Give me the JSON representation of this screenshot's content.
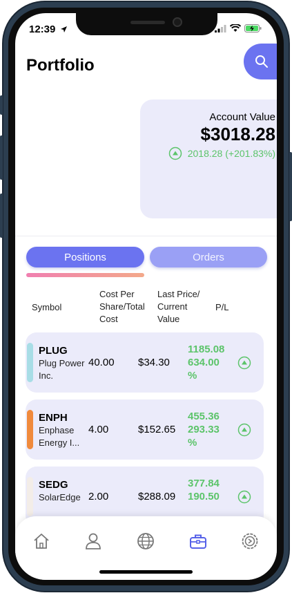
{
  "status": {
    "time": "12:39"
  },
  "header": {
    "title": "Portfolio"
  },
  "account": {
    "label": "Account Value",
    "value": "$3018.28",
    "change": "2018.28 (+201.83%)"
  },
  "tabs": {
    "positions": "Positions",
    "orders": "Orders"
  },
  "columns": {
    "symbol": "Symbol",
    "cost": "Cost Per Share/Total Cost",
    "price": "Last Price/ Current Value",
    "pl": "P/L"
  },
  "positions": [
    {
      "symbol": "PLUG",
      "name": "Plug Power Inc.",
      "cost": "40.00",
      "price": "$34.30",
      "pl": "1185.08 634.00 %",
      "color": "#a8dde6"
    },
    {
      "symbol": "ENPH",
      "name": "Enphase Energy I...",
      "cost": "4.00",
      "price": "$152.65",
      "pl": "455.36 293.33 %",
      "color": "#f08a3c"
    },
    {
      "symbol": "SEDG",
      "name": "SolarEdge",
      "cost": "2.00",
      "price": "$288.09",
      "pl": "377.84 190.50",
      "color": "#f3ede8"
    }
  ],
  "nav": [
    "home-icon",
    "user-icon",
    "globe-icon",
    "briefcase-icon",
    "settings-icon"
  ],
  "colors": {
    "accent": "#6b73f0",
    "positive": "#5cc46a",
    "card": "#ebebfa"
  }
}
